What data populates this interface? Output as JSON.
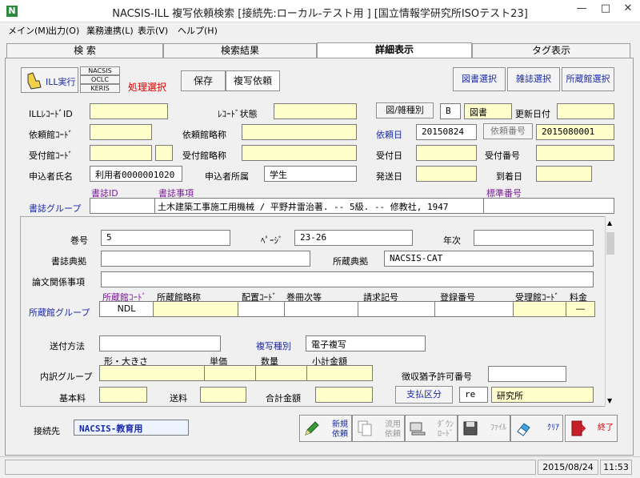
{
  "window": {
    "title": "NACSIS-ILL 複写依頼検索 [接続先:ローカル-テスト用 ] [国立情報学研究所ISOテスト23]",
    "app_icon": "N"
  },
  "menu": [
    "メイン(M)",
    "出力(O)",
    "業務連携(L)",
    "表示(V)",
    "ヘルプ(H)"
  ],
  "tabs": [
    "検 索",
    "検索結果",
    "詳細表示",
    "タグ表示"
  ],
  "toolbar": {
    "ill_exec": "ILL実行",
    "systems": [
      "NACSIS",
      "OCLC",
      "KERIS"
    ],
    "process_select": "処理選択",
    "save": "保存",
    "copy_request": "複写依頼",
    "book_select": "図書選択",
    "journal_select": "雑誌選択",
    "holding_select": "所蔵館選択"
  },
  "fields": {
    "ill_record_id": {
      "label": "ILLﾚｺｰﾄﾞID",
      "value": ""
    },
    "record_status": {
      "label": "ﾚｺｰﾄﾞ状態",
      "value": ""
    },
    "book_journal_type": {
      "button": "図/雑種別",
      "code": "B",
      "value": "図書"
    },
    "update_date": {
      "label": "更新日付",
      "value": ""
    },
    "requesting_library_code": {
      "label": "依頼館ｺｰﾄﾞ",
      "value": ""
    },
    "requesting_library_name": {
      "label": "依頼館略称",
      "value": ""
    },
    "request_date": {
      "label": "依頼日",
      "value": "20150824"
    },
    "request_number": {
      "button": "依頼番号",
      "value": "2015080001"
    },
    "receiving_library_code": {
      "label": "受付館ｺｰﾄﾞ",
      "value": ""
    },
    "receiving_library_name": {
      "label": "受付館略称",
      "value": ""
    },
    "receipt_date": {
      "label": "受付日",
      "value": ""
    },
    "receipt_number": {
      "label": "受付番号",
      "value": ""
    },
    "applicant_name": {
      "label": "申込者氏名",
      "value": "利用者0000001020"
    },
    "applicant_affiliation": {
      "label": "申込者所属",
      "value": "学生"
    },
    "send_date": {
      "label": "発送日",
      "value": ""
    },
    "arrival_date": {
      "label": "到着日",
      "value": ""
    }
  },
  "bib_group": {
    "label": "書誌グループ",
    "id_header": "書誌ID",
    "item_header": "書誌事項",
    "std_header": "標準番号",
    "id": "",
    "item": "土木建築工事施工用機械 / 平野井雷治著. -- 5級. -- 修教社, 1947",
    "std": ""
  },
  "detail": {
    "volume": {
      "label": "巻号",
      "value": "5"
    },
    "page": {
      "label": "ﾍﾟｰｼﾞ",
      "value": "23-26"
    },
    "year": {
      "label": "年次",
      "value": ""
    },
    "bib_source": {
      "label": "書誌典拠",
      "value": ""
    },
    "holding_source": {
      "label": "所蔵典拠",
      "value": "NACSIS-CAT"
    },
    "article": {
      "label": "論文関係事項",
      "value": ""
    },
    "holding_group": {
      "label": "所蔵館グループ",
      "headers": [
        "所蔵館ｺｰﾄﾞ",
        "所蔵館略称",
        "配置ｺｰﾄﾞ",
        "巻冊次等",
        "請求記号",
        "登録番号",
        "受理館ｺｰﾄﾞ",
        "料金"
      ],
      "row": [
        "NDL",
        "",
        "",
        "",
        "",
        "",
        "",
        "―"
      ]
    },
    "send_method": {
      "label": "送付方法",
      "value": ""
    },
    "copy_type": {
      "label": "複写種別",
      "value": "電子複写"
    },
    "breakdown": {
      "label": "内訳グループ",
      "headers": [
        "形・大きさ",
        "単価",
        "数量",
        "小計金額"
      ]
    },
    "permit_no": {
      "label": "徴収猶予許可番号",
      "value": ""
    },
    "base_fee": {
      "label": "基本料",
      "value": ""
    },
    "shipping": {
      "label": "送料",
      "value": ""
    },
    "total": {
      "label": "合計金額",
      "value": ""
    },
    "payment": {
      "button": "支払区分",
      "code": "re",
      "value": "研究所"
    }
  },
  "connection": {
    "label": "接続先",
    "value": "NACSIS-教育用"
  },
  "actions": [
    {
      "label": "新規\n依頼",
      "icon": "pencil-icon"
    },
    {
      "label": "流用\n依頼",
      "icon": "copy-document-icon"
    },
    {
      "label": "ﾀﾞｳﾝ\nﾛｰﾄﾞ",
      "icon": "download-computer-icon"
    },
    {
      "label": "ﾌｧｲﾙ",
      "icon": "floppy-disk-icon"
    },
    {
      "label": "ｸﾘｱ",
      "icon": "eraser-icon"
    },
    {
      "label": "終了",
      "icon": "exit-door-icon"
    }
  ],
  "status": {
    "date": "2015/08/24",
    "time": "11:53"
  },
  "colors": {
    "field_yellow": "#ffffcc",
    "label_blue": "#1a2aa8",
    "label_purple": "#7a1a9a",
    "label_red": "#d40000"
  }
}
